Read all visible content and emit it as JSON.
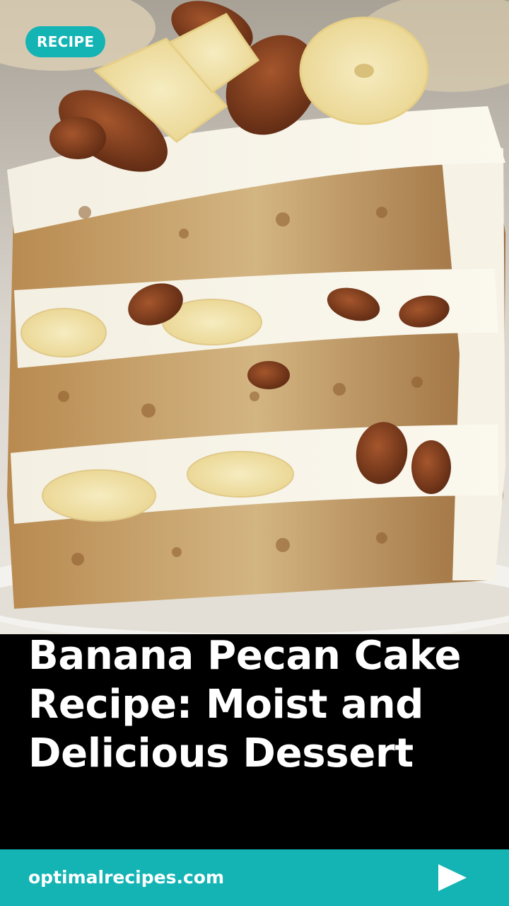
{
  "badge": {
    "label": "RECIPE"
  },
  "hero": {
    "image": "banana-pecan-cake-slice-photo"
  },
  "headline": {
    "lines": [
      "Banana Pecan Cake",
      "Recipe: Moist and",
      "Delicious Dessert"
    ]
  },
  "footer": {
    "site": "optimalrecipes.com",
    "next_icon": "play-arrow-icon"
  },
  "colors": {
    "accent": "#14b4b4",
    "background": "#000000",
    "text": "#ffffff"
  }
}
